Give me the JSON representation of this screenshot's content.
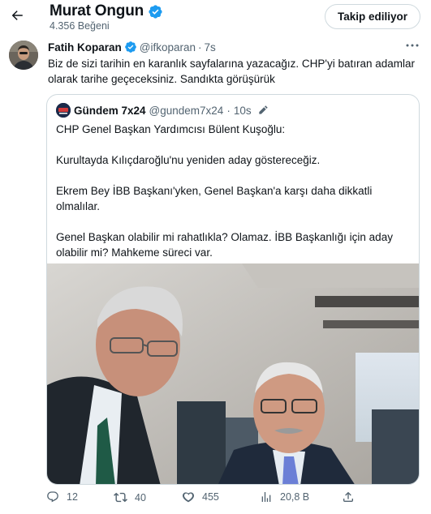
{
  "header": {
    "profile_name": "Murat Ongun",
    "likes_count": "4.356 Beğeni",
    "follow_button": "Takip ediliyor"
  },
  "tweet": {
    "author_name": "Fatih Koparan",
    "handle": "@ifkoparan",
    "separator": "·",
    "time": "7s",
    "text": "Biz de sizi tarihin en karanlık sayfalarına yazacağız. CHP'yi batıran adamlar olarak tarihe geçeceksiniz. Sandıkta görüşürük"
  },
  "quote": {
    "avatar_text": "Gündem 7x24",
    "author_name": "Gündem 7x24",
    "handle": "@gundem7x24",
    "separator": "·",
    "time": "10s",
    "lines": [
      "CHP Genel Başkan Yardımcısı Bülent Kuşoğlu:",
      "Kurultayda Kılıçdaroğlu'nu yeniden aday göstereceğiz.",
      "Ekrem Bey İBB Başkanı'yken, Genel Başkan'a karşı daha dikkatli olmalılar.",
      "Genel Başkan olabilir mi rahatlıkla? Olamaz. İBB Başkanlığı için aday olabilir mi? Mahkeme süreci var."
    ]
  },
  "actions": {
    "replies": "12",
    "retweets": "40",
    "likes": "455",
    "views": "20,8 B"
  },
  "colors": {
    "text": "#0f1419",
    "muted": "#536471",
    "border": "#cfd9de",
    "verified": "#1d9bf0"
  }
}
